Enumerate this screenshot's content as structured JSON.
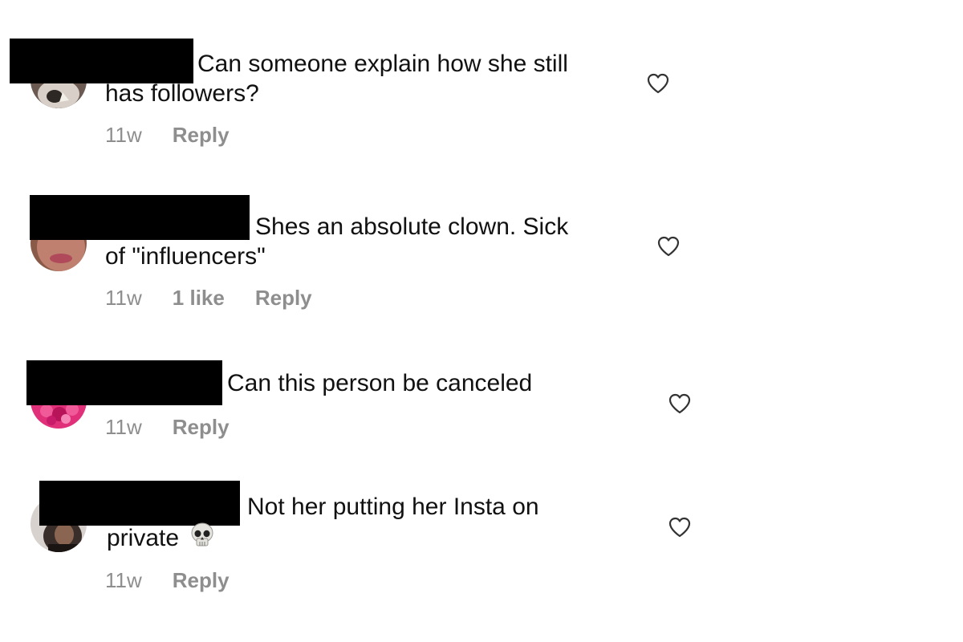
{
  "comments": [
    {
      "line1": "Can someone explain how she still",
      "line2": "has followers?",
      "time": "11w",
      "likes": "",
      "reply": "Reply",
      "avatar_colors": [
        "#6b5a52",
        "#d8d0c8",
        "#2e2824"
      ]
    },
    {
      "line1": "Shes an absolute clown. Sick",
      "line2": "of \"influencers\"",
      "time": "11w",
      "likes": "1 like",
      "reply": "Reply",
      "avatar_colors": [
        "#8a5a48",
        "#c08070",
        "#b0495a"
      ]
    },
    {
      "line1": "Can this person be canceled",
      "line2": "",
      "time": "11w",
      "likes": "",
      "reply": "Reply",
      "avatar_colors": [
        "#e0307a",
        "#f05a98",
        "#b8145a"
      ]
    },
    {
      "line1": "Not her putting her Insta on",
      "line2": "private",
      "time": "11w",
      "likes": "",
      "reply": "Reply",
      "emoji": "skull-icon",
      "avatar_colors": [
        "#d8d2ce",
        "#3a2e2a",
        "#1a1412"
      ]
    }
  ]
}
